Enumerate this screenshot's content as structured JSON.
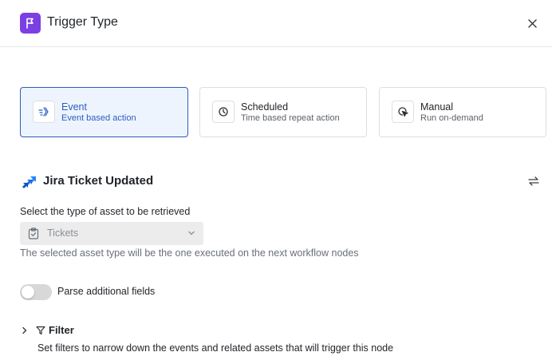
{
  "header": {
    "title": "Trigger Type",
    "icon": "flag-icon",
    "accent_color": "#7b3fe4",
    "close_icon": "close-icon"
  },
  "trigger_types": [
    {
      "title": "Event",
      "subtitle": "Event based action",
      "icon": "event-icon",
      "selected": true
    },
    {
      "title": "Scheduled",
      "subtitle": "Time based repeat action",
      "icon": "clock-icon",
      "selected": false
    },
    {
      "title": "Manual",
      "subtitle": "Run on-demand",
      "icon": "cursor-click-icon",
      "selected": false
    }
  ],
  "integration": {
    "title": "Jira Ticket Updated",
    "icon": "jira-icon",
    "brand_color": "#2684ff",
    "swap_icon": "swap-icon"
  },
  "asset_type": {
    "label": "Select the type of asset to be retrieved",
    "value": "Tickets",
    "icon": "clipboard-icon",
    "helper": "The selected asset type will be the one executed on the next workflow nodes",
    "disabled": true
  },
  "parse_fields": {
    "label": "Parse additional fields",
    "enabled": false
  },
  "filter": {
    "label": "Filter",
    "description": "Set filters to narrow down the events and related assets that will trigger this node",
    "expanded": false
  },
  "colors": {
    "selected_border": "#2d5dbf",
    "selected_bg": "#eef4fe"
  }
}
